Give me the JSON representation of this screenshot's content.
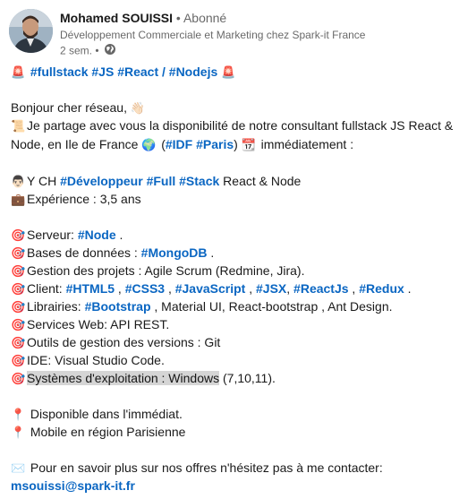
{
  "author": {
    "name": "Mohamed SOUISSI",
    "separator": " • ",
    "follow": "Abonné",
    "headline": "Développement Commerciale et Marketing chez Spark-it France",
    "time": "2 sem.",
    "time_sep": " • "
  },
  "post": {
    "tags_line": {
      "t1": "#fullstack",
      "t2": "#JS",
      "t3": "#React",
      "slash": " / ",
      "t4": "#Nodejs"
    },
    "greeting": "Bonjour cher réseau,",
    "intro": "Je partage avec vous la disponibilité de notre consultant fullstack JS  React & Node, en Ile de France",
    "intro_open": " (",
    "idf": "#IDF",
    "paris": "#Paris",
    "intro_close": ")",
    "intro_end": " immédiatement :",
    "profile": {
      "prefix": "Y CH ",
      "t1": "#Développeur",
      "t2": "#Full",
      "t3": "#Stack",
      "suffix": " React & Node"
    },
    "experience": "Expérience : 3,5 ans",
    "skills": {
      "server_label": "Serveur: ",
      "server_tag": "#Node",
      "server_end": " .",
      "db_label": "Bases de données : ",
      "db_tag": "#MongoDB",
      "db_end": " .",
      "project": "Gestion des projets : Agile Scrum (Redmine, Jira).",
      "client_label": "Client: ",
      "client_tags": [
        "#HTML5",
        "#CSS3",
        "#JavaScript",
        "#JSX",
        "#ReactJs",
        "#Redux"
      ],
      "client_end": " .",
      "libs_label": "Librairies: ",
      "libs_tag": "#Bootstrap",
      "libs_end": " , Material UI, React-bootstrap , Ant Design.",
      "services": "Services Web: API REST.",
      "versions": "Outils de gestion des versions : Git",
      "ide": "IDE: Visual Studio Code.",
      "os_hl": "Systèmes d'exploitation : Windows",
      "os_end": " (7,10,11)."
    },
    "available": "Disponible dans l'immédiat.",
    "mobile": "Mobile en région Parisienne",
    "contact": "Pour en savoir plus sur nos offres n'hésitez pas à me contacter:",
    "email": "msouissi@spark-it.fr"
  }
}
